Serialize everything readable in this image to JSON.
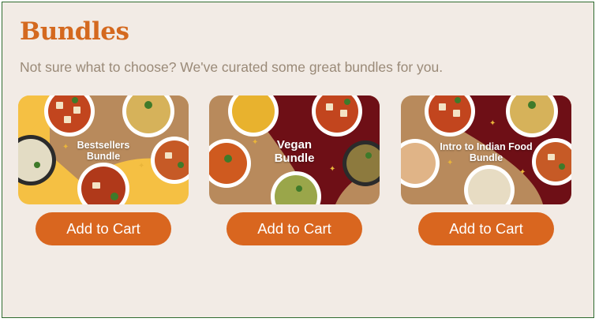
{
  "section": {
    "title": "Bundles",
    "subtitle": "Not sure what to choose? We've curated some great bundles for you."
  },
  "bundles": [
    {
      "name_line1": "Bestsellers",
      "name_line2": "Bundle",
      "button_label": "Add to Cart"
    },
    {
      "name_line1": "Vegan",
      "name_line2": "Bundle",
      "button_label": "Add to Cart"
    },
    {
      "name_line1": "Intro to Indian Food",
      "name_line2": "Bundle",
      "button_label": "Add to Cart"
    }
  ],
  "colors": {
    "accent": "#d9661f",
    "title": "#d4691f",
    "background": "#f2ebe5",
    "tan": "#b88a5c",
    "maroon": "#6e0f16",
    "yellow": "#f5c043"
  }
}
